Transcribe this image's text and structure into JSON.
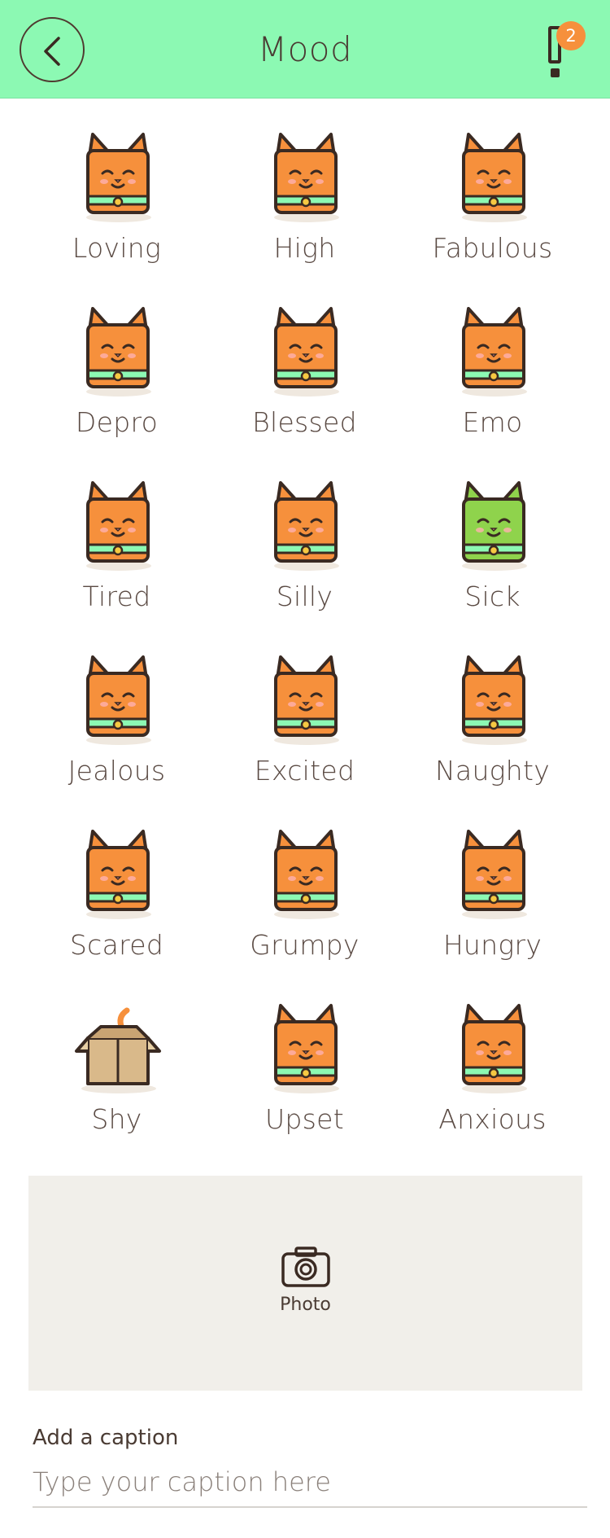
{
  "header": {
    "title": "Mood",
    "notification_count": "2"
  },
  "moods": [
    {
      "label": "Loving",
      "icon": "cat-loving-icon",
      "color": "#f6903c"
    },
    {
      "label": "High",
      "icon": "cat-high-icon",
      "color": "#f6903c"
    },
    {
      "label": "Fabulous",
      "icon": "cat-fabulous-icon",
      "color": "#f6903c"
    },
    {
      "label": "Depro",
      "icon": "cat-depro-icon",
      "color": "#f6903c"
    },
    {
      "label": "Blessed",
      "icon": "cat-blessed-icon",
      "color": "#f6903c"
    },
    {
      "label": "Emo",
      "icon": "cat-emo-icon",
      "color": "#f6903c"
    },
    {
      "label": "Tired",
      "icon": "cat-tired-icon",
      "color": "#f6903c"
    },
    {
      "label": "Silly",
      "icon": "cat-silly-icon",
      "color": "#f6903c"
    },
    {
      "label": "Sick",
      "icon": "cat-sick-icon",
      "color": "#8fd34c"
    },
    {
      "label": "Jealous",
      "icon": "cat-jealous-icon",
      "color": "#f6903c"
    },
    {
      "label": "Excited",
      "icon": "cat-excited-icon",
      "color": "#f6903c"
    },
    {
      "label": "Naughty",
      "icon": "cat-naughty-icon",
      "color": "#f6903c"
    },
    {
      "label": "Scared",
      "icon": "cat-scared-icon",
      "color": "#f6903c"
    },
    {
      "label": "Grumpy",
      "icon": "cat-grumpy-icon",
      "color": "#f6903c"
    },
    {
      "label": "Hungry",
      "icon": "cat-hungry-icon",
      "color": "#f6903c"
    },
    {
      "label": "Shy",
      "icon": "cat-shy-box-icon",
      "color": "#d9b98a"
    },
    {
      "label": "Upset",
      "icon": "cat-upset-icon",
      "color": "#f6903c"
    },
    {
      "label": "Anxious",
      "icon": "cat-anxious-icon",
      "color": "#f6903c"
    }
  ],
  "photo": {
    "label": "Photo"
  },
  "caption": {
    "label": "Add a caption",
    "placeholder": "Type your caption here"
  },
  "colors": {
    "header_bg": "#8cf9b3",
    "accent_orange": "#f6903c",
    "collar_mint": "#8cf9b3",
    "outline": "#3a2a22",
    "photo_bg": "#f1efea"
  }
}
